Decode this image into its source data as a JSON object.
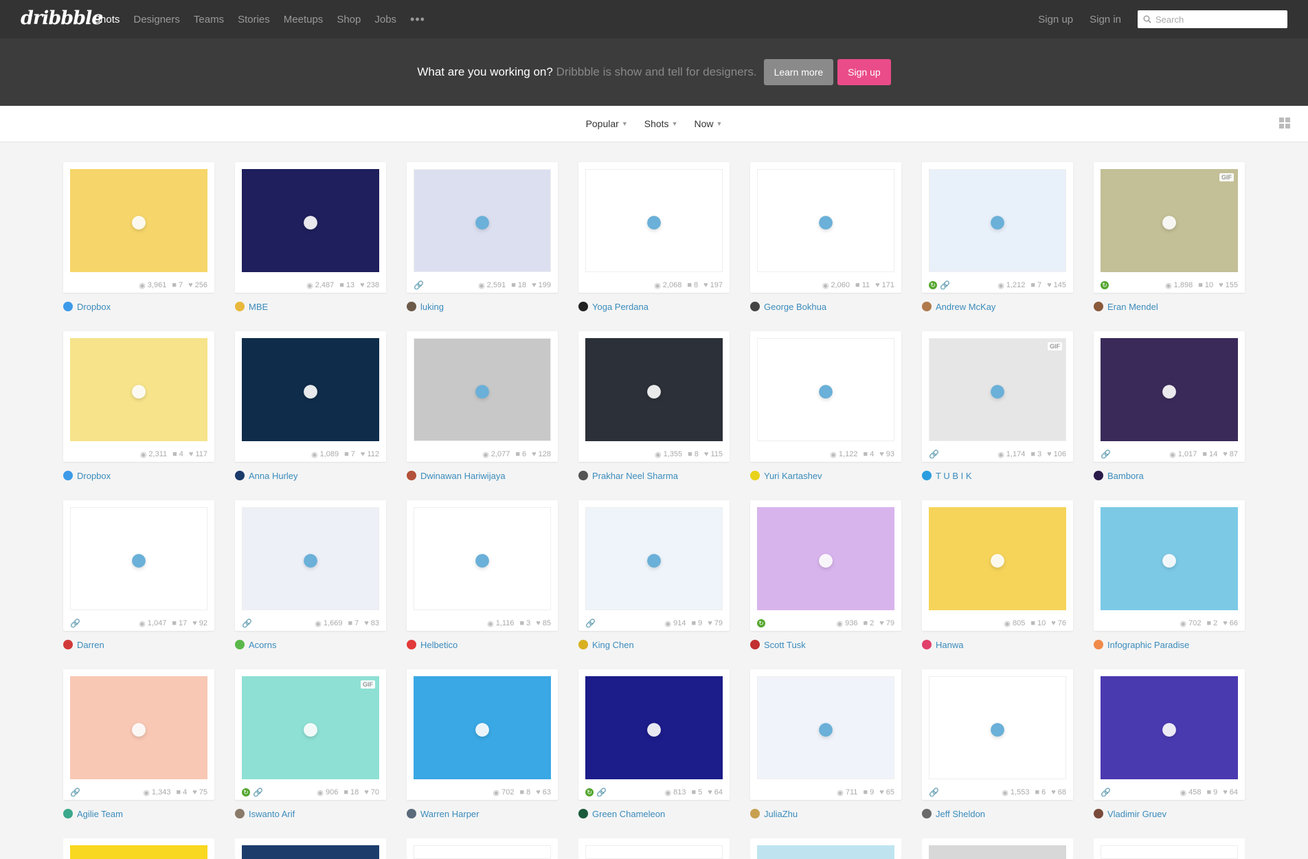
{
  "nav": {
    "logo": "dribbble",
    "links": [
      "Shots",
      "Designers",
      "Teams",
      "Stories",
      "Meetups",
      "Shop",
      "Jobs"
    ],
    "more": "•••",
    "signup": "Sign up",
    "signin": "Sign in",
    "search_placeholder": "Search"
  },
  "banner": {
    "lead": "What are you working on?",
    "sub": "Dribbble is show and tell for designers.",
    "learn_more": "Learn more",
    "sign_up": "Sign up"
  },
  "filters": {
    "sort": "Popular",
    "type": "Shots",
    "time": "Now"
  },
  "shots": [
    {
      "author": "Dropbox",
      "views": "3,961",
      "comments": "7",
      "likes": "256",
      "bg": "#f6d66a",
      "avatar": "#3d9ae8",
      "attach": false,
      "rebound": false,
      "gif": false,
      "icon": "dropbox-promo-icon"
    },
    {
      "author": "MBE",
      "views": "2,487",
      "comments": "13",
      "likes": "238",
      "bg": "#1e1f5c",
      "avatar": "#e8b83c",
      "attach": false,
      "rebound": false,
      "gif": false,
      "icon": "ghost-icon"
    },
    {
      "author": "luking",
      "views": "2,591",
      "comments": "18",
      "likes": "199",
      "bg": "#dcdff0",
      "avatar": "#6b5a4a",
      "attach": true,
      "rebound": false,
      "gif": false,
      "icon": "dashboard-icon"
    },
    {
      "author": "Yoga Perdana",
      "views": "2,068",
      "comments": "8",
      "likes": "197",
      "bg": "#ffffff",
      "avatar": "#222222",
      "attach": false,
      "rebound": false,
      "gif": false,
      "icon": "letter-c-icon"
    },
    {
      "author": "George Bokhua",
      "views": "2,060",
      "comments": "11",
      "likes": "171",
      "bg": "#ffffff",
      "avatar": "#444444",
      "attach": false,
      "rebound": false,
      "gif": false,
      "icon": "monogram-icon"
    },
    {
      "author": "Andrew McKay",
      "views": "1,212",
      "comments": "7",
      "likes": "145",
      "bg": "#e8f0fa",
      "avatar": "#b07a4c",
      "attach": true,
      "rebound": true,
      "gif": false,
      "icon": "onboarding-icon"
    },
    {
      "author": "Eran Mendel",
      "views": "1,898",
      "comments": "10",
      "likes": "155",
      "bg": "#c3bf96",
      "avatar": "#8a5a3a",
      "attach": false,
      "rebound": true,
      "gif": true,
      "icon": "illustration-icon"
    },
    {
      "author": "Dropbox",
      "views": "2,311",
      "comments": "4",
      "likes": "117",
      "bg": "#f6e38a",
      "avatar": "#3d9ae8",
      "attach": false,
      "rebound": false,
      "gif": false,
      "icon": "wastebasket-icon"
    },
    {
      "author": "Anna Hurley",
      "views": "1,089",
      "comments": "7",
      "likes": "112",
      "bg": "#0f2c4a",
      "avatar": "#1a3a6a",
      "attach": false,
      "rebound": false,
      "gif": false,
      "icon": "campfire-icon"
    },
    {
      "author": "Dwinawan Hariwijaya",
      "views": "2,077",
      "comments": "6",
      "likes": "128",
      "bg": "#c8c8c8",
      "avatar": "#b3513a",
      "attach": false,
      "rebound": false,
      "gif": false,
      "icon": "whiteboard-icon"
    },
    {
      "author": "Prakhar Neel Sharma",
      "views": "1,355",
      "comments": "8",
      "likes": "115",
      "bg": "#2c3038",
      "avatar": "#555555",
      "attach": false,
      "rebound": false,
      "gif": false,
      "icon": "finance-app-icon"
    },
    {
      "author": "Yuri Kartashev",
      "views": "1,122",
      "comments": "4",
      "likes": "93",
      "bg": "#ffffff",
      "avatar": "#e8d21c",
      "attach": false,
      "rebound": false,
      "gif": false,
      "icon": "bear-icon"
    },
    {
      "author": "T U B I K",
      "views": "1,174",
      "comments": "3",
      "likes": "106",
      "bg": "#e6e6e6",
      "avatar": "#2a9de0",
      "attach": true,
      "rebound": false,
      "gif": true,
      "icon": "fitness-site-icon"
    },
    {
      "author": "Bambora",
      "views": "1,017",
      "comments": "14",
      "likes": "87",
      "bg": "#3a2a5a",
      "avatar": "#2a1a4a",
      "attach": true,
      "rebound": false,
      "gif": false,
      "icon": "phone-chart-icon"
    },
    {
      "author": "Darren",
      "views": "1,047",
      "comments": "17",
      "likes": "92",
      "bg": "#ffffff",
      "avatar": "#d23a3a",
      "attach": true,
      "rebound": false,
      "gif": false,
      "icon": "pagoda-icon"
    },
    {
      "author": "Acorns",
      "views": "1,669",
      "comments": "7",
      "likes": "83",
      "bg": "#eef0f8",
      "avatar": "#5ab84a",
      "attach": true,
      "rebound": false,
      "gif": false,
      "icon": "website-icon"
    },
    {
      "author": "Helbetico",
      "views": "1,116",
      "comments": "3",
      "likes": "85",
      "bg": "#ffffff",
      "avatar": "#e23a3a",
      "attach": false,
      "rebound": false,
      "gif": false,
      "icon": "robot-icon"
    },
    {
      "author": "King Chen",
      "views": "914",
      "comments": "9",
      "likes": "79",
      "bg": "#eef4fa",
      "avatar": "#d8b020",
      "attach": true,
      "rebound": false,
      "gif": false,
      "icon": "city-cards-icon"
    },
    {
      "author": "Scott Tusk",
      "views": "936",
      "comments": "2",
      "likes": "79",
      "bg": "#d8b4ec",
      "avatar": "#c23030",
      "attach": false,
      "rebound": true,
      "gif": false,
      "icon": "rainbow-houses-icon"
    },
    {
      "author": "Hanwa",
      "views": "805",
      "comments": "10",
      "likes": "76",
      "bg": "#f6d45a",
      "avatar": "#e0406a",
      "attach": false,
      "rebound": false,
      "gif": false,
      "icon": "app-screens-icon"
    },
    {
      "author": "Infographic Paradise",
      "views": "702",
      "comments": "2",
      "likes": "66",
      "bg": "#7cc9e6",
      "avatar": "#f08a4a",
      "attach": false,
      "rebound": false,
      "gif": false,
      "icon": "ship-icon"
    },
    {
      "author": "Agilie Team",
      "views": "1,343",
      "comments": "4",
      "likes": "75",
      "bg": "#f8c8b4",
      "avatar": "#3aa88a",
      "attach": true,
      "rebound": false,
      "gif": false,
      "icon": "map-app-icon"
    },
    {
      "author": "Iswanto Arif",
      "views": "906",
      "comments": "18",
      "likes": "70",
      "bg": "#8ee0d4",
      "avatar": "#8a7a6a",
      "attach": true,
      "rebound": true,
      "gif": true,
      "icon": "profile-card-icon"
    },
    {
      "author": "Warren Harper",
      "views": "702",
      "comments": "8",
      "likes": "63",
      "bg": "#3aa8e4",
      "avatar": "#5a6a7a",
      "attach": false,
      "rebound": false,
      "gif": false,
      "icon": "isometric-room-icon"
    },
    {
      "author": "Green Chameleon",
      "views": "813",
      "comments": "5",
      "likes": "64",
      "bg": "#1c1c8a",
      "avatar": "#1a5a3a",
      "attach": true,
      "rebound": true,
      "gif": false,
      "icon": "bottle-site-icon"
    },
    {
      "author": "JuliaZhu",
      "views": "711",
      "comments": "9",
      "likes": "65",
      "bg": "#f0f4fa",
      "avatar": "#c8a050",
      "attach": false,
      "rebound": false,
      "gif": false,
      "icon": "fan-icon"
    },
    {
      "author": "Jeff Sheldon",
      "views": "1,553",
      "comments": "6",
      "likes": "68",
      "bg": "#ffffff",
      "avatar": "#6a6a6a",
      "attach": true,
      "rebound": false,
      "gif": false,
      "icon": "ugmonk-site-icon"
    },
    {
      "author": "Vladimir Gruev",
      "views": "458",
      "comments": "9",
      "likes": "64",
      "bg": "#4a3ab0",
      "avatar": "#7a4a3a",
      "attach": true,
      "rebound": false,
      "gif": false,
      "icon": "night-cards-icon"
    }
  ],
  "partial_row_colors": [
    "#f8d820",
    "#1c3c6c",
    "#ffffff",
    "#ffffff",
    "#bfe4f0",
    "#d8d8d8",
    "#ffffff"
  ]
}
